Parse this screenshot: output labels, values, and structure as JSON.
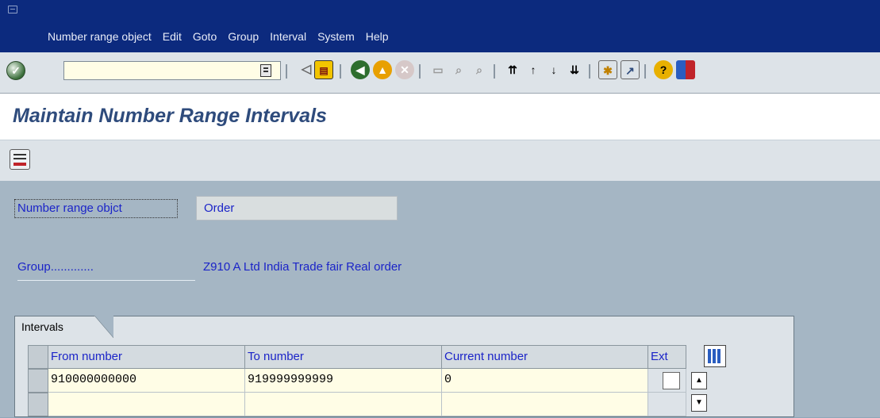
{
  "menubar": {
    "items": [
      "Number range object",
      "Edit",
      "Goto",
      "Group",
      "Interval",
      "System",
      "Help"
    ]
  },
  "toolbar": {
    "command_field_value": "",
    "icons": [
      "ok-icon",
      "history-icon",
      "back-arrow-icon",
      "save-icon",
      "back-icon",
      "exit-icon",
      "cancel-icon",
      "print-icon",
      "find-icon",
      "find-next-icon",
      "first-page-icon",
      "prev-page-icon",
      "next-page-icon",
      "last-page-icon",
      "new-session-icon",
      "shortcut-icon",
      "help-icon",
      "layout-icon"
    ]
  },
  "title_bar": {
    "title": "Maintain Number Range Intervals"
  },
  "app_toolbar": {
    "icons": [
      "insert-interval-icon"
    ]
  },
  "form": {
    "object_label": "Number range objct",
    "object_value": "Order",
    "group_label": "Group.............",
    "group_value": "Z910 A Ltd India Trade fair Real order"
  },
  "intervals": {
    "tab_label": "Intervals",
    "columns": [
      "From number",
      "To number",
      "Current number",
      "Ext"
    ],
    "rows": [
      {
        "from": "910000000000",
        "to": "919999999999",
        "current": "0",
        "ext": false
      }
    ]
  },
  "colors": {
    "menubar_bg": "#0c2a7e",
    "content_bg": "#a5b6c4",
    "title_color": "#2e4b7c",
    "label_color": "#1b24c8"
  }
}
